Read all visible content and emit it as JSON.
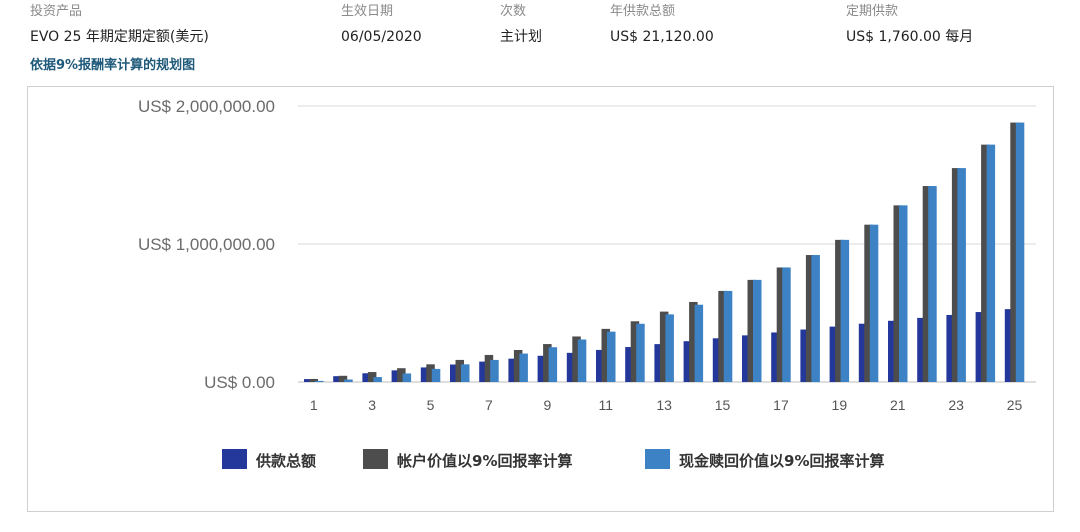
{
  "header": {
    "col1": {
      "label": "投资产品",
      "value": "EVO 25 年期定期定额(美元)"
    },
    "col2": {
      "label": "生效日期",
      "value": "06/05/2020"
    },
    "col3": {
      "label": "次数",
      "value": "主计划"
    },
    "col4": {
      "label": "年供款总额",
      "value": "US$ 21,120.00"
    },
    "col5": {
      "label": "定期供款",
      "value": "US$ 1,760.00 每月"
    }
  },
  "subtitle": "依据9%报酬率计算的规划图",
  "chart_data": {
    "type": "bar",
    "title": "",
    "xlabel": "",
    "ylabel": "",
    "ylim": [
      0,
      2000000
    ],
    "yticks": [
      {
        "value": 0,
        "label": "US$ 0.00"
      },
      {
        "value": 1000000,
        "label": "US$ 1,000,000.00"
      },
      {
        "value": 2000000,
        "label": "US$ 2,000,000.00"
      }
    ],
    "categories": [
      "1",
      "2",
      "3",
      "4",
      "5",
      "6",
      "7",
      "8",
      "9",
      "10",
      "11",
      "12",
      "13",
      "14",
      "15",
      "16",
      "17",
      "18",
      "19",
      "20",
      "21",
      "22",
      "23",
      "24",
      "25"
    ],
    "xtick_labels": [
      "1",
      "3",
      "5",
      "7",
      "9",
      "11",
      "13",
      "15",
      "17",
      "19",
      "21",
      "23",
      "25"
    ],
    "grid": true,
    "legend_position": "bottom",
    "series": [
      {
        "name": "供款总额",
        "color": "#23389a",
        "values": [
          21120,
          42240,
          63360,
          84480,
          105600,
          126720,
          147840,
          168960,
          190080,
          211200,
          232320,
          253440,
          274560,
          295680,
          316800,
          337920,
          359040,
          380160,
          401280,
          422400,
          443520,
          464640,
          485760,
          506880,
          528000
        ]
      },
      {
        "name": "帐户价值以9%回报率计算",
        "color": "#4d4d4d",
        "values": [
          22000,
          45000,
          72000,
          100000,
          128000,
          160000,
          196000,
          232000,
          275000,
          330000,
          385000,
          440000,
          510000,
          580000,
          660000,
          740000,
          830000,
          920000,
          1030000,
          1140000,
          1280000,
          1420000,
          1550000,
          1720000,
          1880000
        ]
      },
      {
        "name": "现金赎回价值以9%回报率计算",
        "color": "#3d82c4",
        "values": [
          8000,
          18000,
          36000,
          62000,
          95000,
          128000,
          160000,
          206000,
          252000,
          308000,
          365000,
          422000,
          490000,
          560000,
          660000,
          740000,
          830000,
          920000,
          1030000,
          1140000,
          1280000,
          1420000,
          1550000,
          1720000,
          1880000
        ]
      }
    ]
  }
}
